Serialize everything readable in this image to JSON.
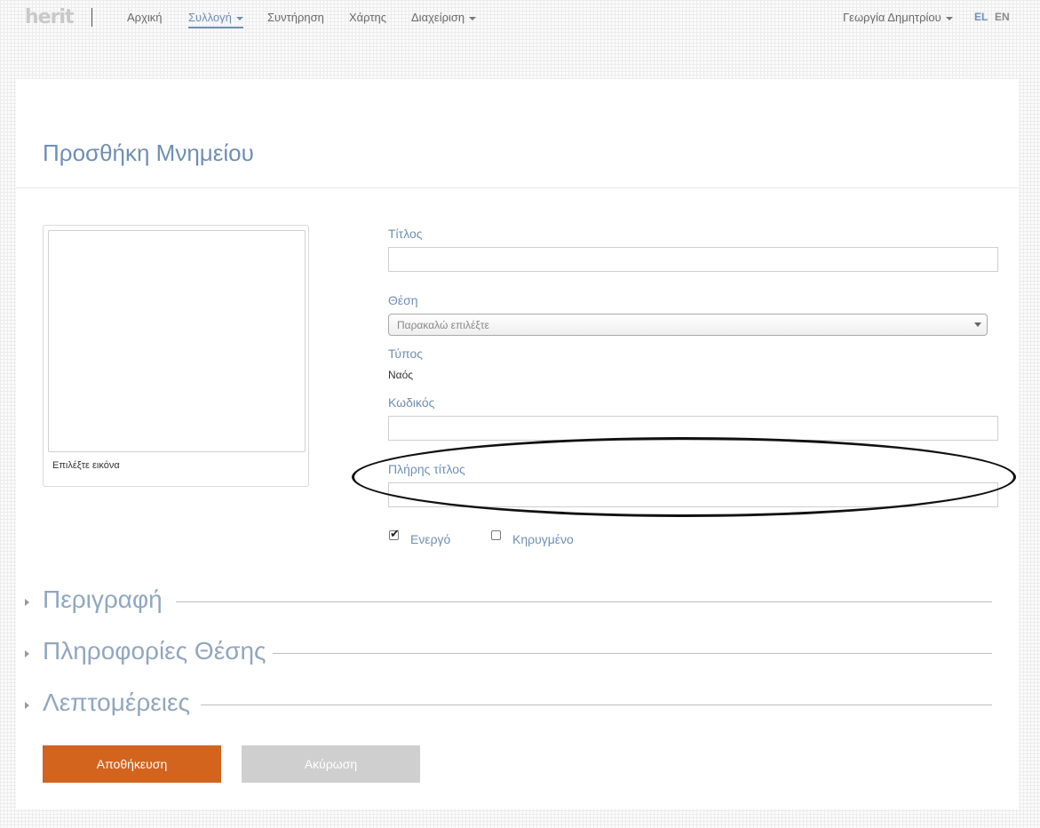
{
  "app": {
    "logo_text": "herit"
  },
  "nav": {
    "items": [
      {
        "label": "Αρχική"
      },
      {
        "label": "Συλλογή"
      },
      {
        "label": "Συντήρηση"
      },
      {
        "label": "Χάρτης"
      },
      {
        "label": "Διαχείριση"
      }
    ],
    "active_item": "Συλλογή",
    "user_name": "Γεωργία Δημητρίου",
    "languages": [
      "EL",
      "EN"
    ],
    "active_language": "EL"
  },
  "page": {
    "title": "Προσθήκη Μνημείου"
  },
  "image_panel": {
    "caption": "Επιλέξτε εικόνα"
  },
  "form": {
    "title_label": "Τίτλος",
    "title_value": "",
    "location_label": "Θέση",
    "location_placeholder": "Παρακαλώ επιλέξτε",
    "type_label": "Τύπος",
    "type_value": "Ναός",
    "code_label": "Κωδικός",
    "code_value": "",
    "full_title_label": "Πλήρης τίτλος",
    "full_title_value": "",
    "active_label": "Ενεργό",
    "active_checked": true,
    "published_label": "Κηρυγμένο",
    "published_checked": false
  },
  "sections": [
    {
      "title": "Περιγραφή"
    },
    {
      "title": "Πληροφορίες Θέσης"
    },
    {
      "title": "Λεπτομέρειες"
    }
  ],
  "buttons": {
    "save_label": "Αποθήκευση",
    "cancel_label": "Ακύρωση"
  },
  "colors": {
    "accent": "#6f8fb3",
    "primary_button": "#d2641e",
    "secondary_button": "#cfcfcf",
    "annotation_ellipse": "#111111"
  }
}
